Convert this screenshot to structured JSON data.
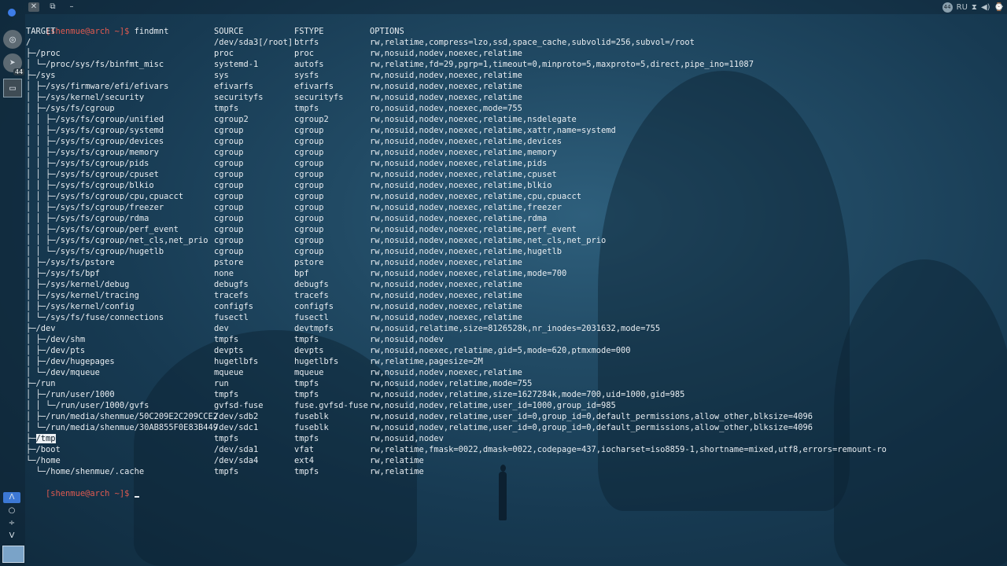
{
  "topbar": {
    "close_glyph": "✕",
    "float_glyph": "⧉",
    "minimize_glyph": "–",
    "tray": {
      "badge": "44",
      "language": "RU",
      "icons": [
        "network-icon",
        "volume-icon",
        "clock-icon"
      ]
    }
  },
  "dock": {
    "badge": "44",
    "bottom": {
      "up": "Λ",
      "circle": "○",
      "cross": "÷",
      "down": "V"
    }
  },
  "terminal": {
    "command_prompt": "[shenmue@arch ~]$",
    "command": "findmnt",
    "header": {
      "target": "TARGET",
      "source": "SOURCE",
      "fstype": "FSTYPE",
      "options": "OPTIONS"
    },
    "rows": [
      {
        "target": "/",
        "source": "/dev/sda3[/root]",
        "fstype": "btrfs",
        "options": "rw,relatime,compress=lzo,ssd,space_cache,subvolid=256,subvol=/root"
      },
      {
        "target": "├─/proc",
        "source": "proc",
        "fstype": "proc",
        "options": "rw,nosuid,nodev,noexec,relatime"
      },
      {
        "target": "│ └─/proc/sys/fs/binfmt_misc",
        "source": "systemd-1",
        "fstype": "autofs",
        "options": "rw,relatime,fd=29,pgrp=1,timeout=0,minproto=5,maxproto=5,direct,pipe_ino=11087"
      },
      {
        "target": "├─/sys",
        "source": "sys",
        "fstype": "sysfs",
        "options": "rw,nosuid,nodev,noexec,relatime"
      },
      {
        "target": "│ ├─/sys/firmware/efi/efivars",
        "source": "efivarfs",
        "fstype": "efivarfs",
        "options": "rw,nosuid,nodev,noexec,relatime"
      },
      {
        "target": "│ ├─/sys/kernel/security",
        "source": "securityfs",
        "fstype": "securityfs",
        "options": "rw,nosuid,nodev,noexec,relatime"
      },
      {
        "target": "│ ├─/sys/fs/cgroup",
        "source": "tmpfs",
        "fstype": "tmpfs",
        "options": "ro,nosuid,nodev,noexec,mode=755"
      },
      {
        "target": "│ │ ├─/sys/fs/cgroup/unified",
        "source": "cgroup2",
        "fstype": "cgroup2",
        "options": "rw,nosuid,nodev,noexec,relatime,nsdelegate"
      },
      {
        "target": "│ │ ├─/sys/fs/cgroup/systemd",
        "source": "cgroup",
        "fstype": "cgroup",
        "options": "rw,nosuid,nodev,noexec,relatime,xattr,name=systemd"
      },
      {
        "target": "│ │ ├─/sys/fs/cgroup/devices",
        "source": "cgroup",
        "fstype": "cgroup",
        "options": "rw,nosuid,nodev,noexec,relatime,devices"
      },
      {
        "target": "│ │ ├─/sys/fs/cgroup/memory",
        "source": "cgroup",
        "fstype": "cgroup",
        "options": "rw,nosuid,nodev,noexec,relatime,memory"
      },
      {
        "target": "│ │ ├─/sys/fs/cgroup/pids",
        "source": "cgroup",
        "fstype": "cgroup",
        "options": "rw,nosuid,nodev,noexec,relatime,pids"
      },
      {
        "target": "│ │ ├─/sys/fs/cgroup/cpuset",
        "source": "cgroup",
        "fstype": "cgroup",
        "options": "rw,nosuid,nodev,noexec,relatime,cpuset"
      },
      {
        "target": "│ │ ├─/sys/fs/cgroup/blkio",
        "source": "cgroup",
        "fstype": "cgroup",
        "options": "rw,nosuid,nodev,noexec,relatime,blkio"
      },
      {
        "target": "│ │ ├─/sys/fs/cgroup/cpu,cpuacct",
        "source": "cgroup",
        "fstype": "cgroup",
        "options": "rw,nosuid,nodev,noexec,relatime,cpu,cpuacct"
      },
      {
        "target": "│ │ ├─/sys/fs/cgroup/freezer",
        "source": "cgroup",
        "fstype": "cgroup",
        "options": "rw,nosuid,nodev,noexec,relatime,freezer"
      },
      {
        "target": "│ │ ├─/sys/fs/cgroup/rdma",
        "source": "cgroup",
        "fstype": "cgroup",
        "options": "rw,nosuid,nodev,noexec,relatime,rdma"
      },
      {
        "target": "│ │ ├─/sys/fs/cgroup/perf_event",
        "source": "cgroup",
        "fstype": "cgroup",
        "options": "rw,nosuid,nodev,noexec,relatime,perf_event"
      },
      {
        "target": "│ │ ├─/sys/fs/cgroup/net_cls,net_prio",
        "source": "cgroup",
        "fstype": "cgroup",
        "options": "rw,nosuid,nodev,noexec,relatime,net_cls,net_prio"
      },
      {
        "target": "│ │ └─/sys/fs/cgroup/hugetlb",
        "source": "cgroup",
        "fstype": "cgroup",
        "options": "rw,nosuid,nodev,noexec,relatime,hugetlb"
      },
      {
        "target": "│ ├─/sys/fs/pstore",
        "source": "pstore",
        "fstype": "pstore",
        "options": "rw,nosuid,nodev,noexec,relatime"
      },
      {
        "target": "│ ├─/sys/fs/bpf",
        "source": "none",
        "fstype": "bpf",
        "options": "rw,nosuid,nodev,noexec,relatime,mode=700"
      },
      {
        "target": "│ ├─/sys/kernel/debug",
        "source": "debugfs",
        "fstype": "debugfs",
        "options": "rw,nosuid,nodev,noexec,relatime"
      },
      {
        "target": "│ ├─/sys/kernel/tracing",
        "source": "tracefs",
        "fstype": "tracefs",
        "options": "rw,nosuid,nodev,noexec,relatime"
      },
      {
        "target": "│ ├─/sys/kernel/config",
        "source": "configfs",
        "fstype": "configfs",
        "options": "rw,nosuid,nodev,noexec,relatime"
      },
      {
        "target": "│ └─/sys/fs/fuse/connections",
        "source": "fusectl",
        "fstype": "fusectl",
        "options": "rw,nosuid,nodev,noexec,relatime"
      },
      {
        "target": "├─/dev",
        "source": "dev",
        "fstype": "devtmpfs",
        "options": "rw,nosuid,relatime,size=8126528k,nr_inodes=2031632,mode=755"
      },
      {
        "target": "│ ├─/dev/shm",
        "source": "tmpfs",
        "fstype": "tmpfs",
        "options": "rw,nosuid,nodev"
      },
      {
        "target": "│ ├─/dev/pts",
        "source": "devpts",
        "fstype": "devpts",
        "options": "rw,nosuid,noexec,relatime,gid=5,mode=620,ptmxmode=000"
      },
      {
        "target": "│ ├─/dev/hugepages",
        "source": "hugetlbfs",
        "fstype": "hugetlbfs",
        "options": "rw,relatime,pagesize=2M"
      },
      {
        "target": "│ └─/dev/mqueue",
        "source": "mqueue",
        "fstype": "mqueue",
        "options": "rw,nosuid,nodev,noexec,relatime"
      },
      {
        "target": "├─/run",
        "source": "run",
        "fstype": "tmpfs",
        "options": "rw,nosuid,nodev,relatime,mode=755"
      },
      {
        "target": "│ ├─/run/user/1000",
        "source": "tmpfs",
        "fstype": "tmpfs",
        "options": "rw,nosuid,nodev,relatime,size=1627284k,mode=700,uid=1000,gid=985"
      },
      {
        "target": "│ │ └─/run/user/1000/gvfs",
        "source": "gvfsd-fuse",
        "fstype": "fuse.gvfsd-fuse",
        "options": "rw,nosuid,nodev,relatime,user_id=1000,group_id=985"
      },
      {
        "target": "│ ├─/run/media/shenmue/50C209E2C209CCE2",
        "source": "/dev/sdb2",
        "fstype": "fuseblk",
        "options": "rw,nosuid,nodev,relatime,user_id=0,group_id=0,default_permissions,allow_other,blksize=4096"
      },
      {
        "target": "│ └─/run/media/shenmue/30AB855F0E83B449",
        "source": "/dev/sdc1",
        "fstype": "fuseblk",
        "options": "rw,nosuid,nodev,relatime,user_id=0,group_id=0,default_permissions,allow_other,blksize=4096"
      }
    ],
    "tmp_row": {
      "prefix": "├─",
      "target": "/tmp",
      "source": "tmpfs",
      "fstype": "tmpfs",
      "options": "rw,nosuid,nodev"
    },
    "tail_rows": [
      {
        "target": "├─/boot",
        "source": "/dev/sda1",
        "fstype": "vfat",
        "options": "rw,relatime,fmask=0022,dmask=0022,codepage=437,iocharset=iso8859-1,shortname=mixed,utf8,errors=remount-ro"
      },
      {
        "target": "└─/home",
        "source": "/dev/sda4",
        "fstype": "ext4",
        "options": "rw,relatime"
      },
      {
        "target": "  └─/home/shenmue/.cache",
        "source": "tmpfs",
        "fstype": "tmpfs",
        "options": "rw,relatime"
      }
    ],
    "final_prompt": "[shenmue@arch ~]$"
  }
}
